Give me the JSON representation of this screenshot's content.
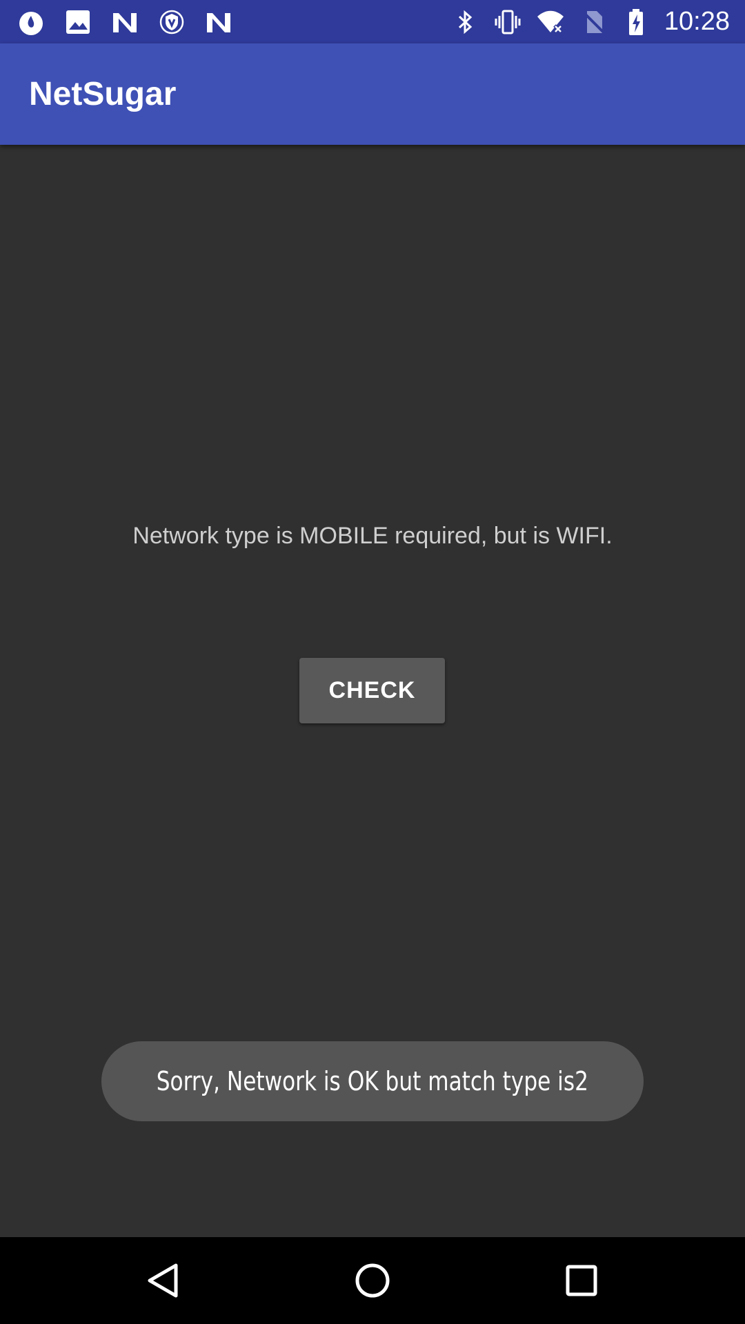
{
  "status_bar": {
    "time": "10:28",
    "left_icons": [
      "droplet-notification-icon",
      "image-notification-icon",
      "n-notification-icon",
      "shield-notification-icon",
      "n-notification-icon"
    ],
    "right_icons": [
      "bluetooth-icon",
      "vibrate-icon",
      "wifi-no-internet-icon",
      "no-sim-icon",
      "battery-charging-icon"
    ],
    "color": "#2f3a9a"
  },
  "app_bar": {
    "title": "NetSugar",
    "color": "#3f51b5"
  },
  "main": {
    "message": "Network type is MOBILE required, but is WIFI.",
    "check_button_label": "CHECK"
  },
  "toast": {
    "text": "Sorry, Network is OK but match type is2"
  },
  "nav_bar": {
    "buttons": [
      "back-icon",
      "home-icon",
      "recents-icon"
    ]
  }
}
